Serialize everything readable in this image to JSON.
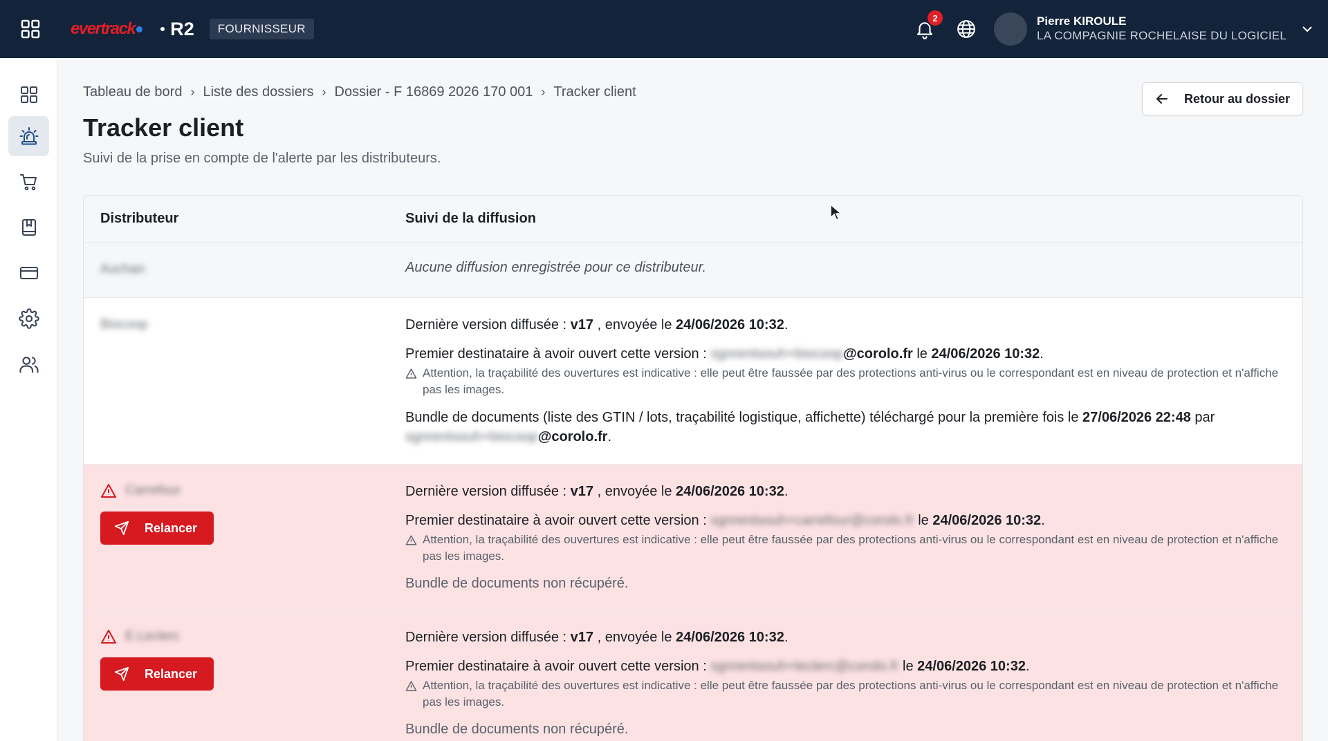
{
  "colors": {
    "topbar": "#13233a",
    "brand_red": "#e21f26",
    "alert_row": "#fde2e4",
    "action_red": "#d71920"
  },
  "header": {
    "logo_text": "evertrack",
    "product": "R2",
    "role_badge": "FOURNISSEUR",
    "notifications_count": "2",
    "user_name": "Pierre KIROULE",
    "user_company": "LA COMPAGNIE ROCHELAISE DU LOGICIEL"
  },
  "sidebar": {
    "items": [
      {
        "icon": "dashboard-grid-icon",
        "active": false
      },
      {
        "icon": "alarm-siren-icon",
        "active": true
      },
      {
        "icon": "shopping-cart-icon",
        "active": false
      },
      {
        "icon": "bookmark-book-icon",
        "active": false
      },
      {
        "icon": "credit-card-icon",
        "active": false
      },
      {
        "icon": "gear-icon",
        "active": false
      },
      {
        "icon": "users-icon",
        "active": false
      }
    ]
  },
  "breadcrumb": {
    "items": [
      "Tableau de bord",
      "Liste des dossiers",
      "Dossier - F 16869 2026 170 001",
      "Tracker client"
    ],
    "separator": "›"
  },
  "page": {
    "title": "Tracker client",
    "subtitle": "Suivi de la prise en compte de l'alerte par les distributeurs.",
    "back_button": "Retour au dossier"
  },
  "table": {
    "headers": [
      "Distributeur",
      "Suivi de la diffusion"
    ],
    "rows": [
      {
        "distributor": "Auchan",
        "alert": false,
        "no_diffusion": "Aucune diffusion enregistrée pour ce distributeur."
      },
      {
        "distributor": "Biocoop",
        "alert": false,
        "version_prefix": "Dernière version diffusée :",
        "version": "v17",
        "sent_prefix": ", envoyée le",
        "sent_date": "24/06/2026 10:32",
        "opened_prefix": "Premier destinataire à avoir ouvert cette version :",
        "opened_email_hidden": "sgnrentsouh+biocoop",
        "opened_email_domain": "@corolo.fr",
        "opened_on": "le",
        "opened_date": "24/06/2026 10:32",
        "warning": "Attention, la traçabilité des ouvertures est indicative : elle peut être faussée par des protections anti-virus ou le correspondant est en niveau de protection et n'affiche pas les images.",
        "bundle_prefix": "Bundle de documents (liste des GTIN / lots, traçabilité logistique, affichette) téléchargé pour la première fois le",
        "bundle_date": "27/06/2026 22:48",
        "bundle_by": "par",
        "bundle_email_hidden": "sgnrentsouh+biocoop",
        "bundle_email_domain": "@corolo.fr"
      },
      {
        "distributor": "Carrefour",
        "alert": true,
        "action": "Relancer",
        "version_prefix": "Dernière version diffusée :",
        "version": "v17",
        "sent_prefix": ", envoyée le",
        "sent_date": "24/06/2026 10:32",
        "opened_prefix": "Premier destinataire à avoir ouvert cette version :",
        "opened_email_hidden": "sgnrentsouh+carrefour@corolo.fr",
        "opened_on": "le",
        "opened_date": "24/06/2026 10:32",
        "warning": "Attention, la traçabilité des ouvertures est indicative : elle peut être faussée par des protections anti-virus ou le correspondant est en niveau de protection et n'affiche pas les images.",
        "bundle_status": "Bundle de documents non récupéré."
      },
      {
        "distributor": "E.Leclerc",
        "alert": true,
        "action": "Relancer",
        "version_prefix": "Dernière version diffusée :",
        "version": "v17",
        "sent_prefix": ", envoyée le",
        "sent_date": "24/06/2026 10:32",
        "opened_prefix": "Premier destinataire à avoir ouvert cette version :",
        "opened_email_hidden": "sgnrentsouh+leclerc@corolo.fr",
        "opened_on": "le",
        "opened_date": "24/06/2026 10:32",
        "warning": "Attention, la traçabilité des ouvertures est indicative : elle peut être faussée par des protections anti-virus ou le correspondant est en niveau de protection et n'affiche pas les images.",
        "bundle_status": "Bundle de documents non récupéré."
      }
    ]
  }
}
